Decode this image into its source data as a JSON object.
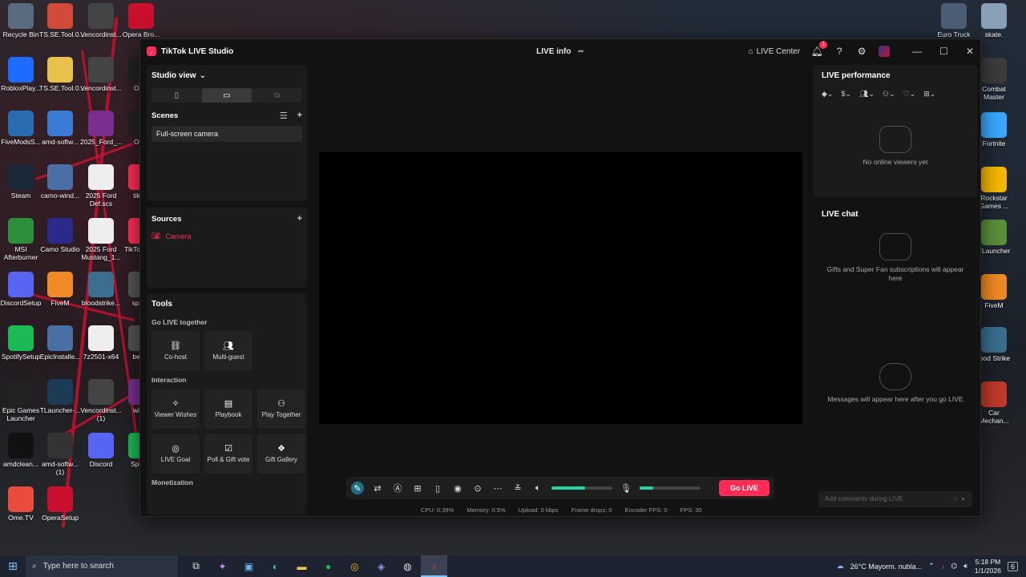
{
  "colors": {
    "accent": "#fe2c55",
    "volume": "#22d3a6",
    "window_bg": "#121212",
    "panel_bg": "#1b1b1b"
  },
  "desktop": {
    "left_icons": [
      {
        "label": "Recycle Bin",
        "icon": "recycle-bin-icon",
        "color": "#5a6b80"
      },
      {
        "label": "TS.SE.Tool.0...",
        "icon": "app-icon",
        "color": "#d24b3a"
      },
      {
        "label": "Vencordinst...",
        "icon": "vencord-icon",
        "color": "#444"
      },
      {
        "label": "Opera Bro...",
        "icon": "opera-icon",
        "color": "#c8102e"
      },
      {
        "label": "RobloxPlay...",
        "icon": "roblox-icon",
        "color": "#1e6bff"
      },
      {
        "label": "TS.SE.Tool.0...",
        "icon": "folder-icon",
        "color": "#e8c24a"
      },
      {
        "label": "Vencordinst...",
        "icon": "vencord-icon",
        "color": "#444"
      },
      {
        "label": "OBS",
        "icon": "obs-icon",
        "color": "#222"
      },
      {
        "label": "FiveModsS...",
        "icon": "fivemods-icon",
        "color": "#2b6cb0"
      },
      {
        "label": "amd-softw...",
        "icon": "shield-icon",
        "color": "#3a7bd5"
      },
      {
        "label": "2025_Ford_...",
        "icon": "winrar-icon",
        "color": "#7a2f8f"
      },
      {
        "label": "OBS",
        "icon": "obs-icon",
        "color": "#222"
      },
      {
        "label": "Steam",
        "icon": "steam-icon",
        "color": "#1b2838"
      },
      {
        "label": "camo-wind...",
        "icon": "installer-icon",
        "color": "#4a6fa5"
      },
      {
        "label": "2025 Ford Def.scs",
        "icon": "file-icon",
        "color": "#eeeeee"
      },
      {
        "label": "tiktok",
        "icon": "tiktok-icon",
        "color": "#fe2c55"
      },
      {
        "label": "MSI Afterburner",
        "icon": "msi-icon",
        "color": "#2d8f3c"
      },
      {
        "label": "Camo Studio",
        "icon": "camo-icon",
        "color": "#2a2a8a"
      },
      {
        "label": "2025 Ford Mustang_1...",
        "icon": "file-icon",
        "color": "#eeeeee"
      },
      {
        "label": "TikTok St...",
        "icon": "tiktok-icon",
        "color": "#fe2c55"
      },
      {
        "label": "DiscordSetup",
        "icon": "discord-icon",
        "color": "#5865f2"
      },
      {
        "label": "FiveM",
        "icon": "fivem-icon",
        "color": "#f08a24"
      },
      {
        "label": "bloodstrike...",
        "icon": "game-icon",
        "color": "#3b6e8f"
      },
      {
        "label": "space",
        "icon": "game-icon",
        "color": "#555"
      },
      {
        "label": "SpotifySetup",
        "icon": "spotify-icon",
        "color": "#1db954"
      },
      {
        "label": "EpicInstalle...",
        "icon": "installer-icon",
        "color": "#4a6fa5"
      },
      {
        "label": "7z2501-x64",
        "icon": "7zip-icon",
        "color": "#eeeeee"
      },
      {
        "label": "beam",
        "icon": "game-icon",
        "color": "#555"
      },
      {
        "label": "Epic Games Launcher",
        "icon": "epic-icon",
        "color": "#222"
      },
      {
        "label": "TLauncher-...",
        "icon": "tlauncher-icon",
        "color": "#1c3b57"
      },
      {
        "label": "Vencordinst... (1)",
        "icon": "vencord-icon",
        "color": "#444"
      },
      {
        "label": "winra",
        "icon": "winrar-icon",
        "color": "#7a2f8f"
      },
      {
        "label": "amdclean...",
        "icon": "amd-icon",
        "color": "#111"
      },
      {
        "label": "amd-softw... (1)",
        "icon": "amd-icon",
        "color": "#333"
      },
      {
        "label": "Discord",
        "icon": "discord-icon",
        "color": "#5865f2"
      },
      {
        "label": "Spotify",
        "icon": "spotify-icon",
        "color": "#1db954"
      },
      {
        "label": "Ome.TV",
        "icon": "ometv-icon",
        "color": "#e94c3d"
      },
      {
        "label": "OperaSetup",
        "icon": "opera-icon",
        "color": "#c8102e"
      }
    ],
    "right_icons": [
      {
        "label": "Euro Truck",
        "icon": "truck-icon",
        "color": "#4d5d74"
      },
      {
        "label": "skate.",
        "icon": "skate-icon",
        "color": "#8aa0b6"
      },
      {
        "label": "Combat Master",
        "icon": "game-icon",
        "color": "#3c3c3c"
      },
      {
        "label": "Fortnite",
        "icon": "fortnite-icon",
        "color": "#3aa8ff"
      },
      {
        "label": "Rockstar Games ...",
        "icon": "rockstar-icon",
        "color": "#f5b700"
      },
      {
        "label": "TLauncher",
        "icon": "minecraft-icon",
        "color": "#5a8f3a"
      },
      {
        "label": "FiveM",
        "icon": "fivem-icon",
        "color": "#f08a24"
      },
      {
        "label": "lood Strike",
        "icon": "game-icon",
        "color": "#3b6e8f"
      },
      {
        "label": "Car Mechan...",
        "icon": "game-icon",
        "color": "#c0392b"
      }
    ]
  },
  "app": {
    "title": "TikTok LIVE Studio",
    "center_title": "LIVE info",
    "live_center": "LIVE Center",
    "notifications": "1"
  },
  "left": {
    "studio_view": "Studio view",
    "scenes": "Scenes",
    "scene_items": [
      "Full-screen camera"
    ],
    "sources": "Sources",
    "source_items": [
      "Camera"
    ],
    "tools": "Tools",
    "sections": [
      {
        "label": "Go LIVE together",
        "items": [
          {
            "label": "Co-host",
            "icon": "link-icon"
          },
          {
            "label": "Multi-guest",
            "icon": "users-icon"
          }
        ]
      },
      {
        "label": "Interaction",
        "items": [
          {
            "label": "Viewer Wishes",
            "icon": "wish-icon"
          },
          {
            "label": "Playbook",
            "icon": "book-icon"
          },
          {
            "label": "Play Together",
            "icon": "controller-icon"
          },
          {
            "label": "LIVE Goal",
            "icon": "target-icon"
          },
          {
            "label": "Poll & Gift vote",
            "icon": "poll-icon"
          },
          {
            "label": "Gift Gallery",
            "icon": "gift-icon"
          }
        ]
      },
      {
        "label": "Monetization",
        "items": []
      }
    ]
  },
  "controls": {
    "go_live": "Go LIVE",
    "speaker_level": 0.55,
    "mic_level": 0.22
  },
  "stats": [
    "CPU:  0.39%",
    "Memory:  0.5%",
    "Upload:  0 kbps",
    "Frame drops:  0",
    "Encoder FPS:  0",
    "FPS:  30"
  ],
  "right": {
    "performance": "LIVE performance",
    "no_viewers": "No online viewers yet",
    "chat": "LIVE chat",
    "gifts_text": "Gifts and Super Fan subscriptions will appear here",
    "messages_text": "Messages will appear here after you go LIVE",
    "chat_placeholder": "Add comments during LIVE"
  },
  "taskbar": {
    "search_placeholder": "Type here to search",
    "weather": "26°C  Mayorm. nubla...",
    "time": "5:18 PM",
    "date": "1/1/2026",
    "notif_count": "6"
  }
}
